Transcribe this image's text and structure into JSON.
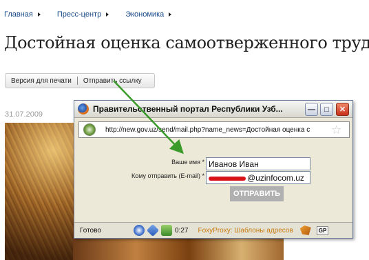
{
  "breadcrumb": [
    "Главная",
    "Пресс-центр",
    "Экономика"
  ],
  "page_title": "Достойная оценка самоотверженного труда",
  "actions": {
    "print": "Версия для печати",
    "send": "Отправить ссылку"
  },
  "date": "31.07.2009",
  "popup": {
    "title": "Правительственный портал Республики Узб...",
    "url": "http://new.gov.uz/send/mail.php?name_news=Достойная оценка с",
    "form": {
      "name_label": "Ваше имя *",
      "name_value": "Иванов Иван",
      "email_label": "Кому отправить (E-mail) *",
      "email_value_visible": "@uzinfocom.uz",
      "submit_label": "ОТПРАВИТЬ"
    },
    "status": {
      "text": "Готово",
      "timer": "0:27",
      "foxyproxy": "FoxyProxy: Шаблоны адресов",
      "gp": "GP"
    },
    "buttons": {
      "minimize": "—",
      "maximize": "□",
      "close": "✕"
    }
  },
  "icons": [
    "firefox-icon",
    "site-globe-icon",
    "bookmark-star-icon",
    "minimize-icon",
    "maximize-icon",
    "close-icon"
  ],
  "colors": {
    "annotation_arrow": "#3a9a2a",
    "redaction": "#d8141a",
    "link": "#1a4a8a"
  }
}
